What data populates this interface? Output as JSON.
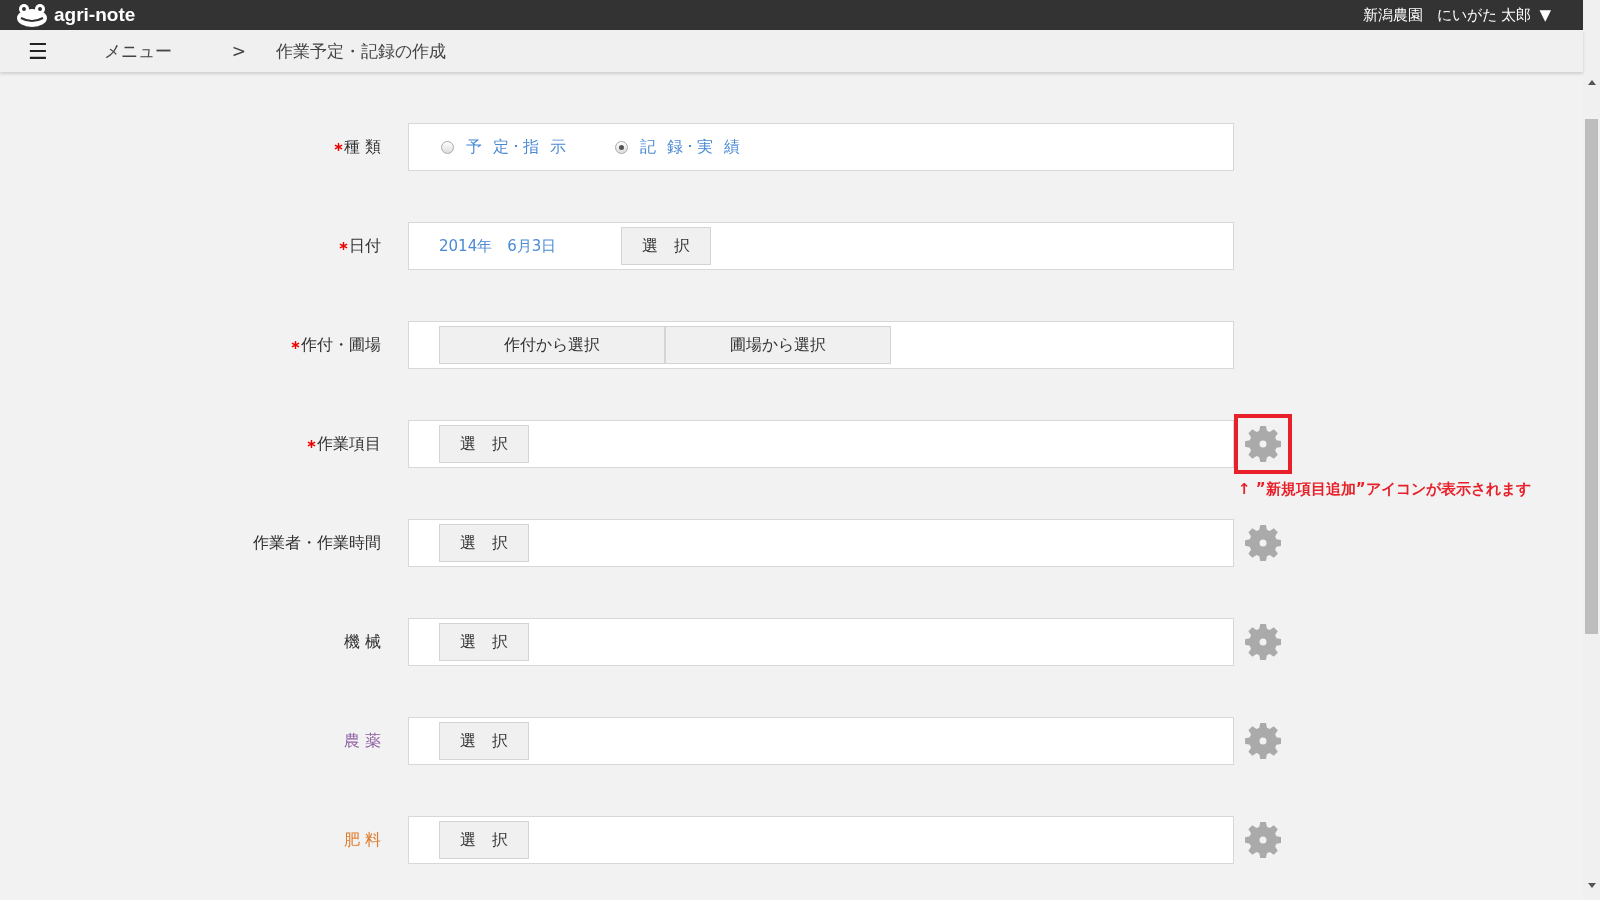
{
  "header": {
    "logo_text": "agri-note",
    "farm": "新潟農園",
    "user": "にいがた 太郎",
    "user_menu_caret": "▼"
  },
  "breadcrumb": {
    "menu_icon": "☰",
    "items": [
      "メニュー",
      "作業予定・記録の作成"
    ],
    "separator": ">"
  },
  "form": {
    "rows": [
      {
        "kind": "radio",
        "label": "種 類",
        "required": true,
        "gear": false,
        "highlighted": false,
        "options": [
          {
            "label": "予 定･指 示",
            "selected": false
          },
          {
            "label": "記 録･実 績",
            "selected": true
          }
        ]
      },
      {
        "kind": "date",
        "label": "日付",
        "required": true,
        "gear": false,
        "highlighted": false,
        "value": "2014年　6月3日",
        "buttons": [
          "選　択"
        ]
      },
      {
        "kind": "buttons",
        "label": "作付・圃場",
        "required": true,
        "gear": false,
        "highlighted": false,
        "buttons": [
          "作付から選択",
          "圃場から選択"
        ]
      },
      {
        "kind": "select",
        "label": "作業項目",
        "required": true,
        "gear": true,
        "highlighted": true,
        "buttons": [
          "選　択"
        ],
        "annotation": "↑ ”新規項目追加”アイコンが表示されます"
      },
      {
        "kind": "select",
        "label": "作業者・作業時間",
        "required": false,
        "gear": true,
        "highlighted": false,
        "buttons": [
          "選　択"
        ]
      },
      {
        "kind": "select",
        "label": "機 械",
        "required": false,
        "gear": true,
        "highlighted": false,
        "buttons": [
          "選　択"
        ]
      },
      {
        "kind": "select",
        "label": "農 薬",
        "color": "#8e5ea2",
        "required": false,
        "gear": true,
        "highlighted": false,
        "buttons": [
          "選　択"
        ]
      },
      {
        "kind": "select",
        "label": "肥 料",
        "color": "#e07b2a",
        "required": false,
        "gear": true,
        "highlighted": false,
        "buttons": [
          "選　択"
        ]
      }
    ]
  }
}
